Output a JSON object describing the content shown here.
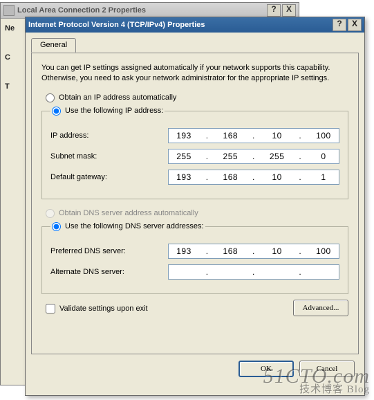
{
  "back_window": {
    "title": "Local Area Connection 2 Properties",
    "side_labels": [
      "Ne",
      "C",
      "T"
    ]
  },
  "dialog": {
    "title": "Internet Protocol Version 4 (TCP/IPv4) Properties",
    "help_char": "?",
    "close_char": "X",
    "tab_label": "General",
    "intro_text": "You can get IP settings assigned automatically if your network supports this capability. Otherwise, you need to ask your network administrator for the appropriate IP settings.",
    "radio_obtain_ip": "Obtain an IP address automatically",
    "radio_use_ip": "Use the following IP address:",
    "ip_fields": {
      "ip_label": "IP address:",
      "ip_value": [
        "193",
        "168",
        "10",
        "100"
      ],
      "subnet_label": "Subnet mask:",
      "subnet_value": [
        "255",
        "255",
        "255",
        "0"
      ],
      "gateway_label": "Default gateway:",
      "gateway_value": [
        "193",
        "168",
        "10",
        "1"
      ]
    },
    "radio_obtain_dns": "Obtain DNS server address automatically",
    "radio_use_dns": "Use the following DNS server addresses:",
    "dns_fields": {
      "pref_label": "Preferred DNS server:",
      "pref_value": [
        "193",
        "168",
        "10",
        "100"
      ],
      "alt_label": "Alternate DNS server:",
      "alt_value": [
        "",
        "",
        "",
        ""
      ]
    },
    "validate_label": "Validate settings upon exit",
    "advanced_label": "Advanced...",
    "ok_label": "OK",
    "cancel_label": "Cancel"
  },
  "watermark": {
    "line1": "51CTO.com",
    "line2": "技术博客 Blog"
  }
}
